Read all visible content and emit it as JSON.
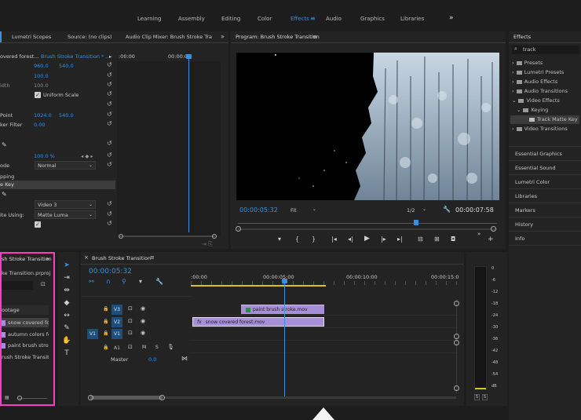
{
  "workspaces": {
    "items": [
      "Learning",
      "Assembly",
      "Editing",
      "Color",
      "Effects",
      "Audio",
      "Graphics",
      "Libraries"
    ],
    "active": "Effects",
    "more": "»"
  },
  "effect_controls": {
    "tabs": [
      "Lumetri Scopes",
      "Source: (no clips)",
      "Audio Clip Mixer: Brush Stroke Trans"
    ],
    "source_clip": "overed forest...",
    "sequence_clip": "Brush Stroke Transition * ...",
    "timecode_start": ":00:00",
    "timecode_current": "00:00:0",
    "position": {
      "x": "960.0",
      "y": "540.0"
    },
    "scale": "100.0",
    "width_label": "idth",
    "width_value": "100.0",
    "uniform_scale": "Uniform Scale",
    "point_label": "Point",
    "anchor": {
      "x": "1024.0",
      "y": "540.0"
    },
    "filter_label": "ker Filter",
    "filter_value": "0.00",
    "opacity_value": "100.0 %",
    "mode_label": "ode",
    "mode_value": "Normal",
    "section_label": "pping",
    "key_label": "e Key",
    "matte_value": "Video 3",
    "composite_label": "ite Using:",
    "composite_value": "Matte Luma"
  },
  "program": {
    "title": "Program: Brush Stroke Transition",
    "timecode": "00:00:05:32",
    "fit": "Fit",
    "quality": "1/2",
    "duration": "00:00:07:58"
  },
  "effects_panel": {
    "title": "Effects",
    "search": "track",
    "tree": [
      {
        "label": "Presets",
        "level": 0
      },
      {
        "label": "Lumetri Presets",
        "level": 0
      },
      {
        "label": "Audio Effects",
        "level": 0
      },
      {
        "label": "Audio Transitions",
        "level": 0
      },
      {
        "label": "Video Effects",
        "level": 0
      },
      {
        "label": "Keying",
        "level": 1
      },
      {
        "label": "Track Matte Key",
        "level": 2
      },
      {
        "label": "Video Transitions",
        "level": 0
      }
    ],
    "panels": [
      "Essential Graphics",
      "Essential Sound",
      "Lumetri Color",
      "Libraries",
      "Markers",
      "History",
      "Info"
    ]
  },
  "project": {
    "title": "sh Stroke Transition",
    "file": "ke Transition.prproj",
    "bin": "ootage",
    "items": [
      "snow covered fo",
      "autumn colors fo",
      "paint brush strok",
      "rush Stroke Transiti"
    ]
  },
  "timeline": {
    "title": "Brush Stroke Transition",
    "timecode": "00:00:05:32",
    "ruler": [
      ":00:00",
      "00:00:05:00",
      "00:00:10:00",
      "00:00:15:0"
    ],
    "tracks": [
      {
        "target": "",
        "name": "V3"
      },
      {
        "target": "",
        "name": "V2"
      },
      {
        "target": "V1",
        "name": "V1"
      },
      {
        "target": "",
        "name": "A1"
      }
    ],
    "master": "Master",
    "master_value": "0.0",
    "clips": [
      "paint brush stroke.mov",
      "snow covered forest.mov"
    ],
    "fx": "fx",
    "audio_buttons": [
      "M",
      "S"
    ]
  },
  "meter": {
    "labels": [
      "0",
      "-6",
      "-12",
      "-18",
      "-24",
      "-30",
      "-36",
      "-42",
      "-48",
      "-54",
      "dB"
    ],
    "solo": [
      "S",
      "S"
    ]
  },
  "colors": {
    "accent": "#3b8fe0",
    "clip": "#a78fd8",
    "highlight": "#ff3cc8",
    "playhead": "#3b8fe0"
  }
}
